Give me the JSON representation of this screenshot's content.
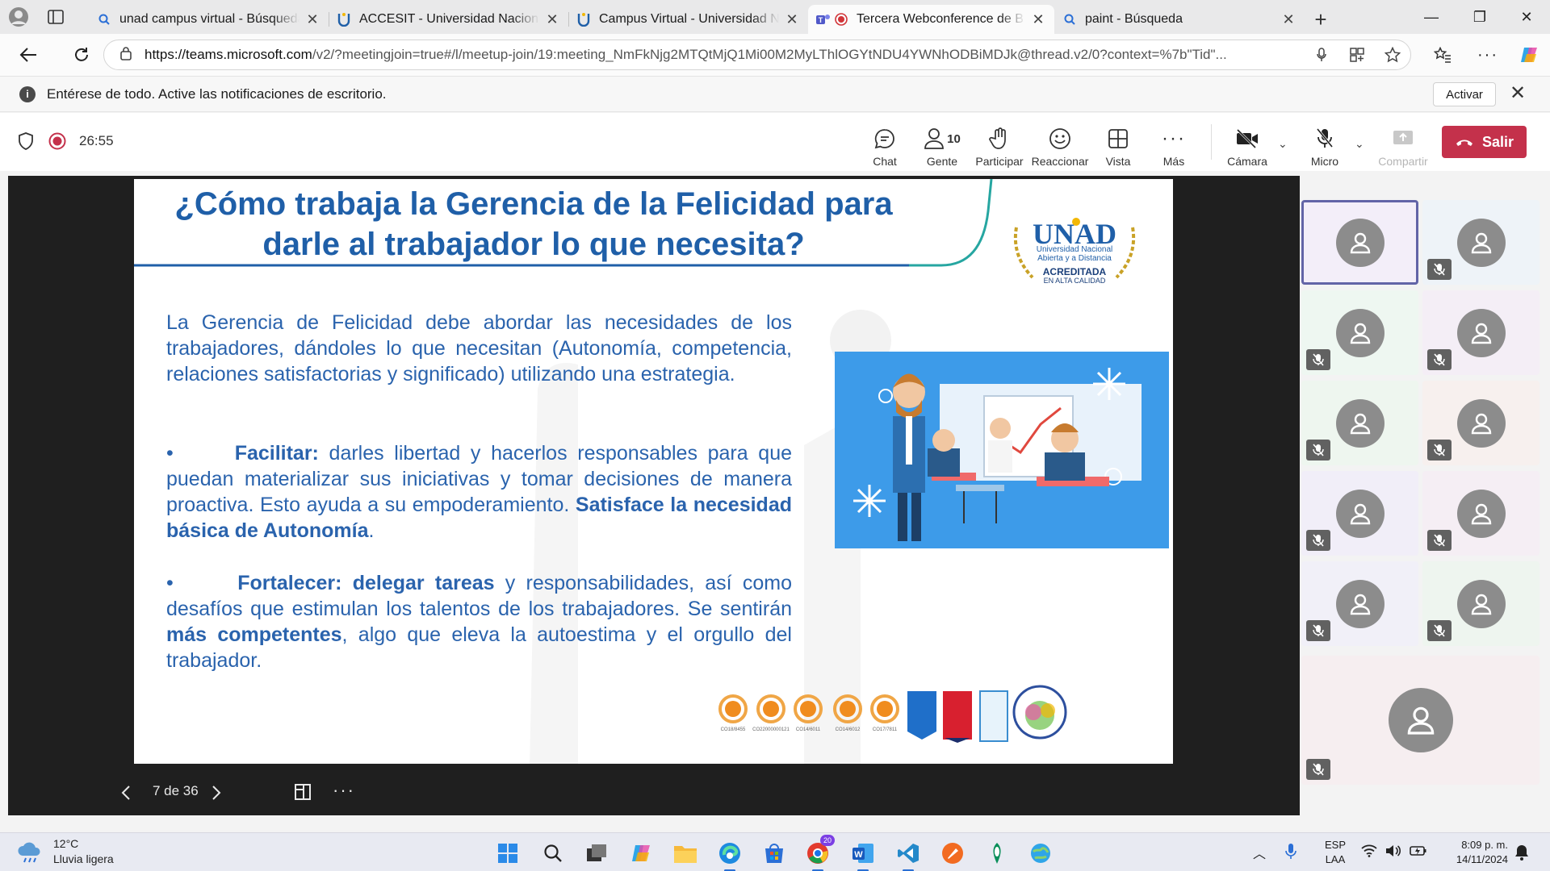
{
  "browser": {
    "tabs": [
      {
        "title": "unad campus virtual - Búsqueda",
        "icon": "search-icon"
      },
      {
        "title": "ACCESIT - Universidad Nacional Abierta",
        "icon": "unad-icon"
      },
      {
        "title": "Campus Virtual - Universidad Nacional",
        "icon": "unad-icon"
      },
      {
        "title": "Tercera Webconference de B",
        "icon": "teams-recording-icon",
        "active": true
      },
      {
        "title": "paint - Búsqueda",
        "icon": "search-icon"
      }
    ],
    "url_host": "https://teams.microsoft.com",
    "url_rest": "/v2/?meetingjoin=true#/l/meetup-join/19:meeting_NmFkNjg2MTQtMjQ1Mi00M2MyLThlOGYtNDU4YWNhODBiMDJk@thread.v2/0?context=%7b\"Tid\"..."
  },
  "notification": {
    "text": "Entérese de todo. Active las notificaciones de escritorio.",
    "action": "Activar"
  },
  "meeting": {
    "timer": "26:55",
    "toolbar": {
      "chat": "Chat",
      "people": "Gente",
      "people_count": "10",
      "raise": "Participar",
      "react": "Reaccionar",
      "view": "Vista",
      "more": "Más",
      "camera": "Cámara",
      "mic": "Micro",
      "share": "Compartir",
      "leave": "Salir"
    }
  },
  "slide": {
    "title_line1": "¿Cómo trabaja la Gerencia de la Felicidad para",
    "title_line2": "darle al trabajador lo que necesita?",
    "paragraph": "La Gerencia de Felicidad debe abordar las necesidades de los trabajadores, dándoles lo que necesitan (Autonomía, competencia, relaciones satisfactorias y significado) utilizando una estrategia.",
    "bullet1": {
      "lead": "Facilitar:",
      "text": " darles libertad y hacerlos responsables para que puedan materializar sus iniciativas y tomar decisiones de manera proactiva. Esto ayuda a su empoderamiento. ",
      "strong": "Satisface la necesidad básica de Autonomía",
      "end": "."
    },
    "bullet2": {
      "lead": "Fortalecer: delegar tareas",
      "text": " y responsabilidades, así como desafíos que estimulan los talentos de los trabajadores. Se sentirán ",
      "strong": "más competentes",
      "end": ", algo que eleva la autoestima y el orgullo del trabajador."
    },
    "logo": {
      "name": "UNAD",
      "line1": "Universidad Nacional",
      "line2": "Abierta y a Distancia",
      "badge1": "ACREDITADA",
      "badge2": "EN ALTA CALIDAD"
    },
    "certs": [
      "CO18/8455",
      "CO22000000121",
      "CO14/6011",
      "CO14/6012",
      "CO17/7811"
    ],
    "page": "7 de 36"
  },
  "gallery": {
    "tiles": 11,
    "muted": [
      false,
      true,
      true,
      true,
      true,
      true,
      true,
      true,
      true,
      true
    ]
  },
  "taskbar": {
    "weather_temp": "12°C",
    "weather_desc": "Lluvia ligera",
    "lang1": "ESP",
    "lang2": "LAA",
    "time": "8:09 p. m.",
    "date": "14/11/2024",
    "copilot_badge": "20"
  }
}
